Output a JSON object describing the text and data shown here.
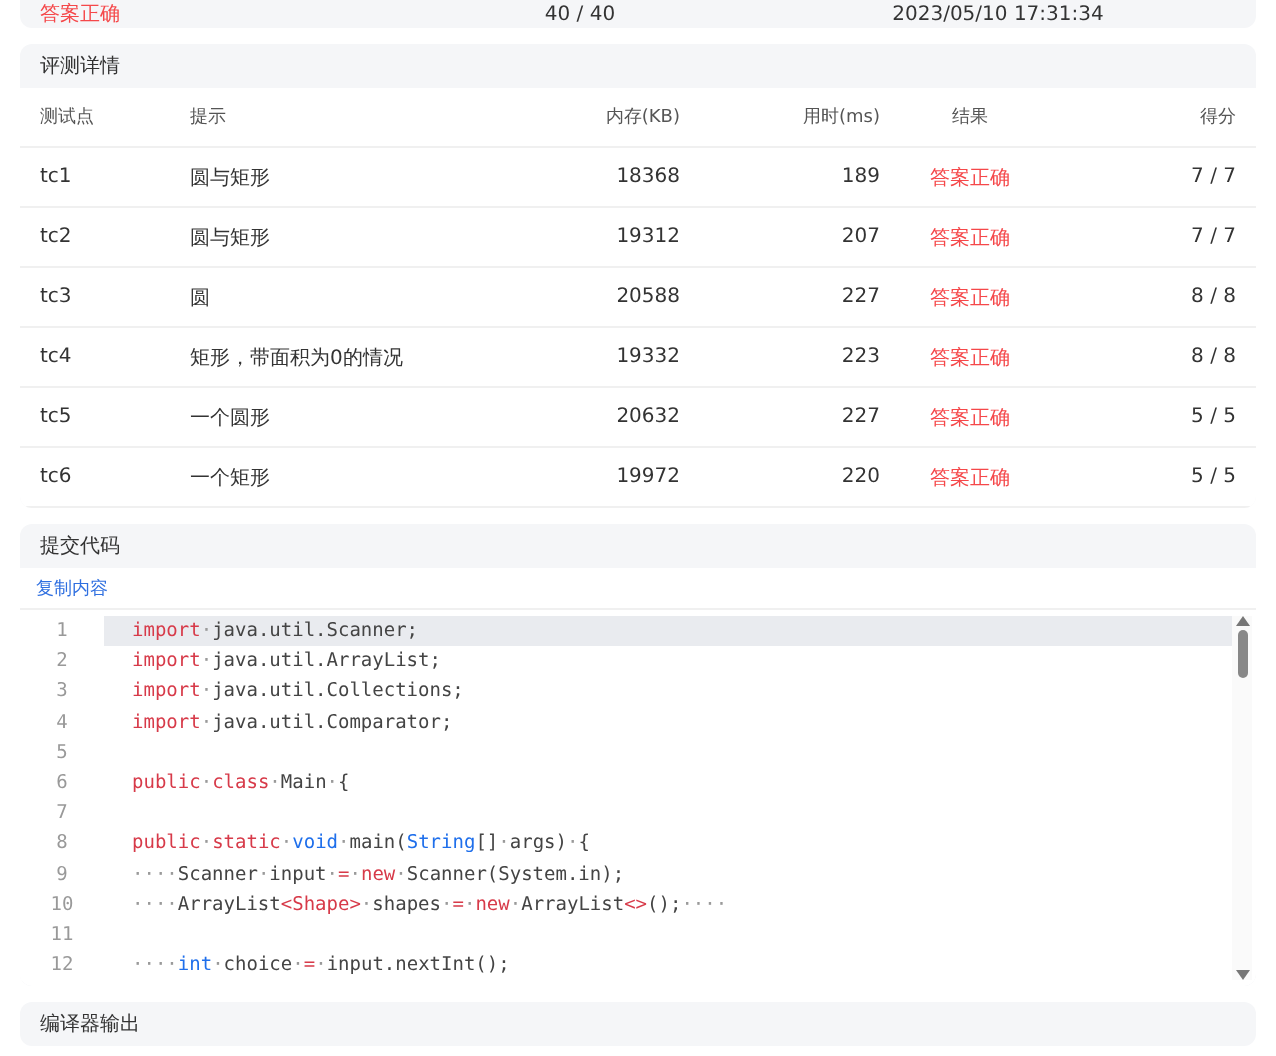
{
  "summary": {
    "result": "答案正确",
    "score": "40 / 40",
    "time": "2023/05/10 17:31:34"
  },
  "details": {
    "title": "评测详情",
    "columns": [
      "测试点",
      "提示",
      "内存(KB)",
      "用时(ms)",
      "结果",
      "得分"
    ],
    "rows": [
      {
        "case": "tc1",
        "hint": "圆与矩形",
        "memory": "18368",
        "time": "189",
        "result": "答案正确",
        "score": "7 / 7"
      },
      {
        "case": "tc2",
        "hint": "圆与矩形",
        "memory": "19312",
        "time": "207",
        "result": "答案正确",
        "score": "7 / 7"
      },
      {
        "case": "tc3",
        "hint": "圆",
        "memory": "20588",
        "time": "227",
        "result": "答案正确",
        "score": "8 / 8"
      },
      {
        "case": "tc4",
        "hint": "矩形，带面积为0的情况",
        "memory": "19332",
        "time": "223",
        "result": "答案正确",
        "score": "8 / 8"
      },
      {
        "case": "tc5",
        "hint": "一个圆形",
        "memory": "20632",
        "time": "227",
        "result": "答案正确",
        "score": "5 / 5"
      },
      {
        "case": "tc6",
        "hint": "一个矩形",
        "memory": "19972",
        "time": "220",
        "result": "答案正确",
        "score": "5 / 5"
      }
    ]
  },
  "code": {
    "title": "提交代码",
    "copy_link": "复制内容",
    "lines": [
      {
        "number": "1",
        "selected": true,
        "tokens": [
          {
            "kind": "keyword",
            "t": "import"
          },
          {
            "kind": "space",
            "t": "·"
          },
          {
            "kind": "plain",
            "t": "java.util.Scanner;"
          }
        ]
      },
      {
        "number": "2",
        "selected": false,
        "tokens": [
          {
            "kind": "keyword",
            "t": "import"
          },
          {
            "kind": "space",
            "t": "·"
          },
          {
            "kind": "plain",
            "t": "java.util.ArrayList;"
          }
        ]
      },
      {
        "number": "3",
        "selected": false,
        "tokens": [
          {
            "kind": "keyword",
            "t": "import"
          },
          {
            "kind": "space",
            "t": "·"
          },
          {
            "kind": "plain",
            "t": "java.util.Collections;"
          }
        ]
      },
      {
        "number": "4",
        "selected": false,
        "tokens": [
          {
            "kind": "keyword",
            "t": "import"
          },
          {
            "kind": "space",
            "t": "·"
          },
          {
            "kind": "plain",
            "t": "java.util.Comparator;"
          }
        ]
      },
      {
        "number": "5",
        "selected": false
      },
      {
        "number": "6",
        "selected": false,
        "tokens": [
          {
            "kind": "keyword",
            "t": "public"
          },
          {
            "kind": "space",
            "t": "·"
          },
          {
            "kind": "keyword",
            "t": "class"
          },
          {
            "kind": "space",
            "t": "·"
          },
          {
            "kind": "plain",
            "t": "Main"
          },
          {
            "kind": "space",
            "t": "·"
          },
          {
            "kind": "plain",
            "t": "{"
          }
        ]
      },
      {
        "number": "7",
        "selected": false
      },
      {
        "number": "8",
        "selected": false,
        "tokens": [
          {
            "kind": "keyword",
            "t": "public"
          },
          {
            "kind": "space",
            "t": "·"
          },
          {
            "kind": "keyword",
            "t": "static"
          },
          {
            "kind": "space",
            "t": "·"
          },
          {
            "kind": "type",
            "t": "void"
          },
          {
            "kind": "space",
            "t": "·"
          },
          {
            "kind": "plain",
            "t": "main("
          },
          {
            "kind": "type",
            "t": "String"
          },
          {
            "kind": "plain",
            "t": "[]"
          },
          {
            "kind": "space",
            "t": "·"
          },
          {
            "kind": "plain",
            "t": "args)"
          },
          {
            "kind": "space",
            "t": "·"
          },
          {
            "kind": "plain",
            "t": "{"
          }
        ]
      },
      {
        "number": "9",
        "selected": false,
        "tokens": [
          {
            "kind": "space",
            "t": "····"
          },
          {
            "kind": "plain",
            "t": "Scanner"
          },
          {
            "kind": "space",
            "t": "·"
          },
          {
            "kind": "plain",
            "t": "input"
          },
          {
            "kind": "space",
            "t": "·"
          },
          {
            "kind": "operator",
            "t": "="
          },
          {
            "kind": "space",
            "t": "·"
          },
          {
            "kind": "keyword",
            "t": "new"
          },
          {
            "kind": "space",
            "t": "·"
          },
          {
            "kind": "plain",
            "t": "Scanner(System.in);"
          }
        ]
      },
      {
        "number": "10",
        "selected": false,
        "tokens": [
          {
            "kind": "space",
            "t": "····"
          },
          {
            "kind": "plain",
            "t": "ArrayList"
          },
          {
            "kind": "operator",
            "t": "<Shape>"
          },
          {
            "kind": "space",
            "t": "·"
          },
          {
            "kind": "plain",
            "t": "shapes"
          },
          {
            "kind": "space",
            "t": "·"
          },
          {
            "kind": "operator",
            "t": "="
          },
          {
            "kind": "space",
            "t": "·"
          },
          {
            "kind": "keyword",
            "t": "new"
          },
          {
            "kind": "space",
            "t": "·"
          },
          {
            "kind": "plain",
            "t": "ArrayList"
          },
          {
            "kind": "operator",
            "t": "<>"
          },
          {
            "kind": "plain",
            "t": "();"
          },
          {
            "kind": "space",
            "t": "····"
          }
        ]
      },
      {
        "number": "11",
        "selected": false
      },
      {
        "number": "12",
        "selected": false,
        "tokens": [
          {
            "kind": "space",
            "t": "····"
          },
          {
            "kind": "type",
            "t": "int"
          },
          {
            "kind": "space",
            "t": "·"
          },
          {
            "kind": "plain",
            "t": "choice"
          },
          {
            "kind": "space",
            "t": "·"
          },
          {
            "kind": "operator",
            "t": "="
          },
          {
            "kind": "space",
            "t": "·"
          },
          {
            "kind": "plain",
            "t": "input.nextInt();"
          }
        ]
      }
    ]
  },
  "compiler": {
    "title": "编译器输出"
  }
}
